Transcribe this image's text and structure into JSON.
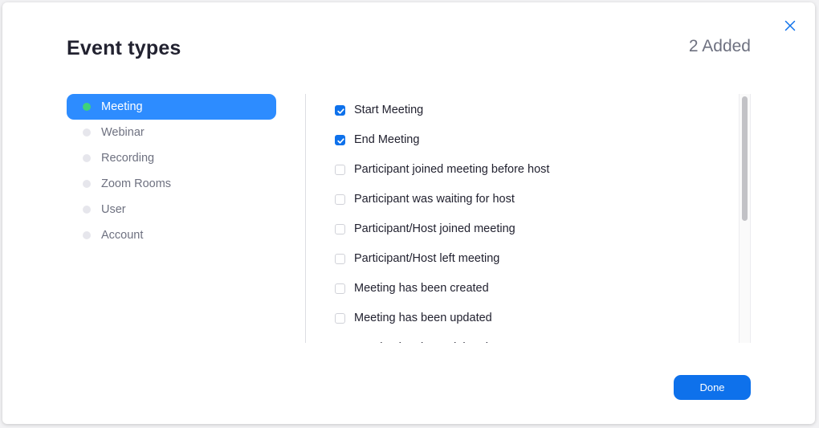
{
  "dialog": {
    "title": "Event types",
    "added_count": "2 Added",
    "done_label": "Done"
  },
  "categories": [
    {
      "label": "Meeting",
      "active": true
    },
    {
      "label": "Webinar",
      "active": false
    },
    {
      "label": "Recording",
      "active": false
    },
    {
      "label": "Zoom Rooms",
      "active": false
    },
    {
      "label": "User",
      "active": false
    },
    {
      "label": "Account",
      "active": false
    }
  ],
  "events": [
    {
      "label": "Start Meeting",
      "checked": true
    },
    {
      "label": "End Meeting",
      "checked": true
    },
    {
      "label": "Participant joined meeting before host",
      "checked": false
    },
    {
      "label": "Participant was waiting for host",
      "checked": false
    },
    {
      "label": "Participant/Host joined meeting",
      "checked": false
    },
    {
      "label": "Participant/Host left meeting",
      "checked": false
    },
    {
      "label": "Meeting has been created",
      "checked": false
    },
    {
      "label": "Meeting has been updated",
      "checked": false
    },
    {
      "label": "Meeting has been deleted",
      "checked": false
    }
  ],
  "icons": {
    "close": "close-icon",
    "checkbox": "checkmark-icon"
  },
  "colors": {
    "accent": "#0e71eb",
    "active_nav": "#2d8cff",
    "active_dot": "#3fd27b",
    "title_text": "#222230",
    "muted_text": "#6e7180"
  }
}
